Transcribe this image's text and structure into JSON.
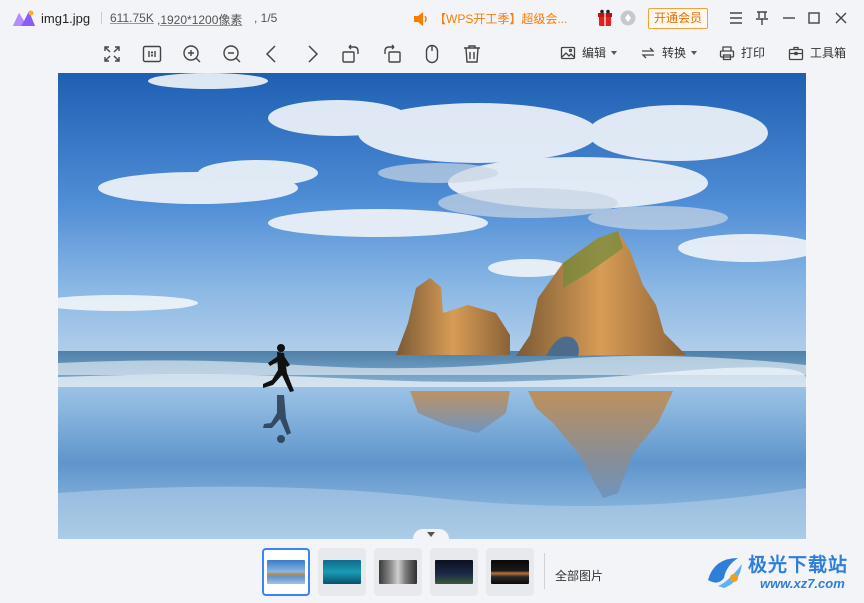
{
  "titlebar": {
    "file_name": "img1.jpg",
    "file_size": "611.75K",
    "dimensions": ",1920*1200像素",
    "position": ", 1/5",
    "promo_text": "【WPS开工季】超级会...",
    "vip_button": "开通会员",
    "icons": [
      "app-logo-icon",
      "speaker-icon",
      "gift-icon",
      "wps-icon",
      "menu-icon",
      "pin-icon",
      "minimize-icon",
      "maximize-icon",
      "close-icon"
    ]
  },
  "toolbar": {
    "tools": [
      "fit-screen-icon",
      "actual-size-icon",
      "zoom-in-icon",
      "zoom-out-icon",
      "previous-icon",
      "next-icon",
      "rotate-left-icon",
      "rotate-right-icon",
      "mouse-icon",
      "delete-icon"
    ],
    "edit_label": "编辑",
    "convert_label": "转换",
    "print_label": "打印",
    "toolbox_label": "工具箱"
  },
  "thumbnails": {
    "all_label": "全部图片",
    "active_index": 0,
    "count": 5
  },
  "watermark": {
    "name": "极光下载站",
    "url": "www.xz7.com"
  },
  "colors": {
    "accent": "#3b82f6",
    "promo": "#ff7a00",
    "background": "#f3f4f7"
  }
}
